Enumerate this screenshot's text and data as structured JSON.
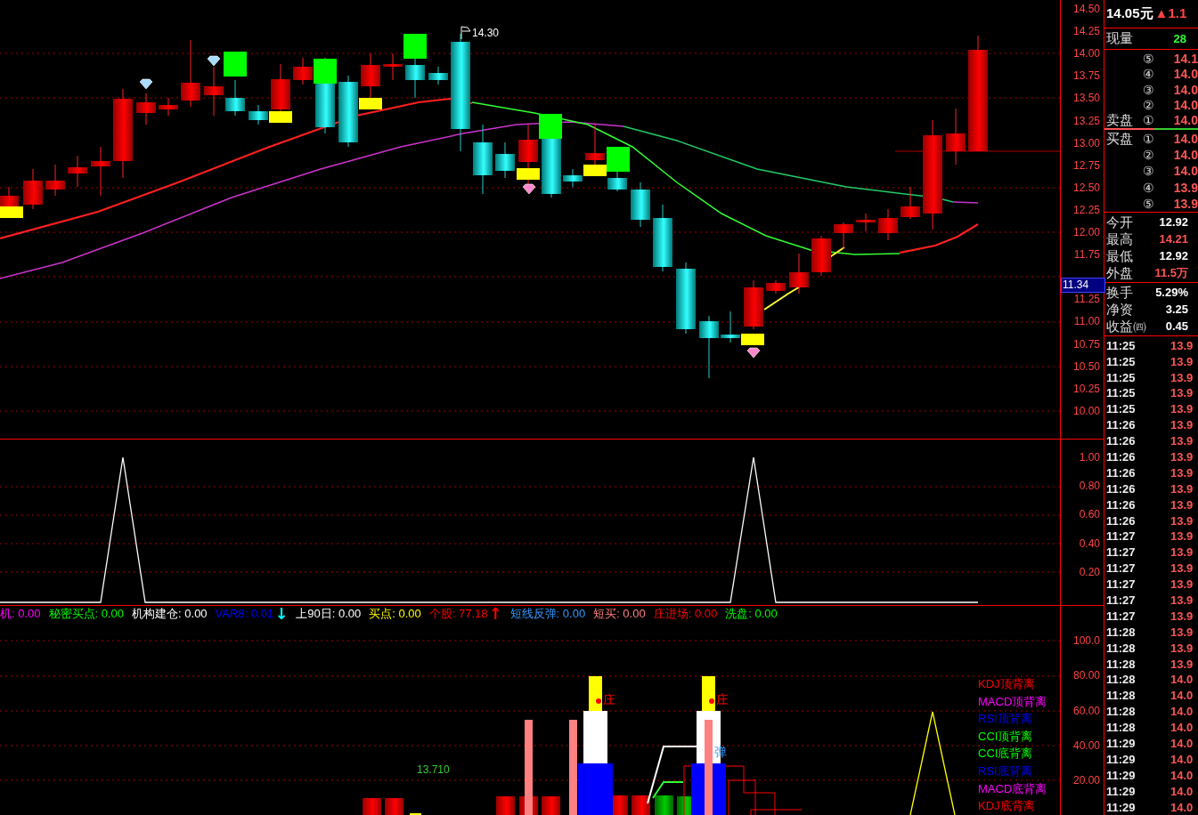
{
  "price_chart": {
    "flag_label": "14.30",
    "price_tag": "11.34",
    "y_ticks": [
      "14.50",
      "14.25",
      "14.00",
      "13.75",
      "13.50",
      "13.25",
      "13.00",
      "12.75",
      "12.50",
      "12.25",
      "12.00",
      "11.75",
      "11.25",
      "11.00",
      "10.75",
      "10.50",
      "10.25",
      "10.00"
    ]
  },
  "oscillator": {
    "y_ticks": [
      "1.00",
      "0.80",
      "0.60",
      "0.40",
      "0.20"
    ]
  },
  "indicator_legend": [
    {
      "text": "机: 0.00",
      "color": "#ff00ff"
    },
    {
      "text": "秘密买点: 0.00",
      "color": "#00ff00"
    },
    {
      "text": "机构建仓: 0.00",
      "color": "#ffffff"
    },
    {
      "text": "VAR8: 0.01",
      "color": "#0000ff"
    },
    {
      "text": "↓",
      "color": "#00ffff",
      "kind": "arrow"
    },
    {
      "text": "上90日: 0.00",
      "color": "#ffffff"
    },
    {
      "text": "买点: 0.00",
      "color": "#ffff00"
    },
    {
      "text": "个股: 77.18",
      "color": "#ff0000"
    },
    {
      "text": "↑",
      "color": "#ff0000",
      "kind": "arrow"
    },
    {
      "text": "短线反弹: 0.00",
      "color": "#3399ff"
    },
    {
      "text": "短买: 0.00",
      "color": "#ff8080"
    },
    {
      "text": "庄进场: 0.00",
      "color": "#ff0000"
    },
    {
      "text": "洗盘: 0.00",
      "color": "#00ff00"
    }
  ],
  "signal_panel": {
    "y_ticks": [
      "100.0",
      "80.00",
      "60.00",
      "40.00",
      "20.00"
    ],
    "value_label": "13.710",
    "markers": [
      {
        "text": "庄"
      },
      {
        "text": "庄"
      },
      {
        "text": "弹"
      }
    ],
    "divergence_labels": [
      {
        "text": "KDJ顶背离",
        "color": "#ff0000"
      },
      {
        "text": "MACD顶背离",
        "color": "#ff00ff"
      },
      {
        "text": "RSI顶背离",
        "color": "#0000ff"
      },
      {
        "text": "CCI顶背离",
        "color": "#00ff00"
      },
      {
        "text": "CCI底背离",
        "color": "#00ff00"
      },
      {
        "text": "RSI底背离",
        "color": "#0000ff"
      },
      {
        "text": "MACD底背离",
        "color": "#ff00ff"
      },
      {
        "text": "KDJ底背离",
        "color": "#ff0000"
      }
    ]
  },
  "quote": {
    "price": "14.05元",
    "change": "▲1.1",
    "volume_label": "现量",
    "volume": "28",
    "asks": [
      {
        "index": "⑤",
        "price": "14.1"
      },
      {
        "index": "④",
        "price": "14.0"
      },
      {
        "index": "③",
        "price": "14.0"
      },
      {
        "index": "②",
        "price": "14.0"
      },
      {
        "label": "卖盘",
        "index": "①",
        "price": "14.0"
      }
    ],
    "bids": [
      {
        "label": "买盘",
        "index": "①",
        "price": "14.0"
      },
      {
        "index": "②",
        "price": "14.0"
      },
      {
        "index": "③",
        "price": "14.0"
      },
      {
        "index": "④",
        "price": "13.9"
      },
      {
        "index": "⑤",
        "price": "13.9"
      }
    ],
    "stats": [
      {
        "label": "今开",
        "value": "12.92",
        "color": "#ffffff"
      },
      {
        "label": "最高",
        "value": "14.21",
        "color": "#ff5555"
      },
      {
        "label": "最低",
        "value": "12.92",
        "color": "#ffffff"
      },
      {
        "label": "外盘",
        "value": "11.5万",
        "color": "#ff5555"
      }
    ],
    "stats_2": [
      {
        "label": "换手",
        "value": "5.29%",
        "color": "#ffffff"
      },
      {
        "label": "净资",
        "value": "3.25",
        "color": "#ffffff"
      },
      {
        "label": "收益㈣",
        "value": "0.45",
        "color": "#ffffff"
      }
    ],
    "ticks": [
      {
        "time": "11:25",
        "price": "13.9"
      },
      {
        "time": "11:25",
        "price": "13.9"
      },
      {
        "time": "11:25",
        "price": "13.9"
      },
      {
        "time": "11:25",
        "price": "13.9"
      },
      {
        "time": "11:25",
        "price": "13.9"
      },
      {
        "time": "11:26",
        "price": "13.9"
      },
      {
        "time": "11:26",
        "price": "13.9"
      },
      {
        "time": "11:26",
        "price": "13.9"
      },
      {
        "time": "11:26",
        "price": "13.9"
      },
      {
        "time": "11:26",
        "price": "13.9"
      },
      {
        "time": "11:26",
        "price": "13.9"
      },
      {
        "time": "11:26",
        "price": "13.9"
      },
      {
        "time": "11:27",
        "price": "13.9"
      },
      {
        "time": "11:27",
        "price": "13.9"
      },
      {
        "time": "11:27",
        "price": "13.9"
      },
      {
        "time": "11:27",
        "price": "13.9"
      },
      {
        "time": "11:27",
        "price": "13.9"
      },
      {
        "time": "11:27",
        "price": "13.9"
      },
      {
        "time": "11:28",
        "price": "13.9"
      },
      {
        "time": "11:28",
        "price": "13.9"
      },
      {
        "time": "11:28",
        "price": "13.9"
      },
      {
        "time": "11:28",
        "price": "14.0"
      },
      {
        "time": "11:28",
        "price": "14.0"
      },
      {
        "time": "11:28",
        "price": "14.0"
      },
      {
        "time": "11:28",
        "price": "14.0"
      },
      {
        "time": "11:29",
        "price": "14.0"
      },
      {
        "time": "11:29",
        "price": "14.0"
      },
      {
        "time": "11:29",
        "price": "14.0"
      },
      {
        "time": "11:29",
        "price": "14.0"
      },
      {
        "time": "11:29",
        "price": "14.0"
      }
    ]
  }
}
